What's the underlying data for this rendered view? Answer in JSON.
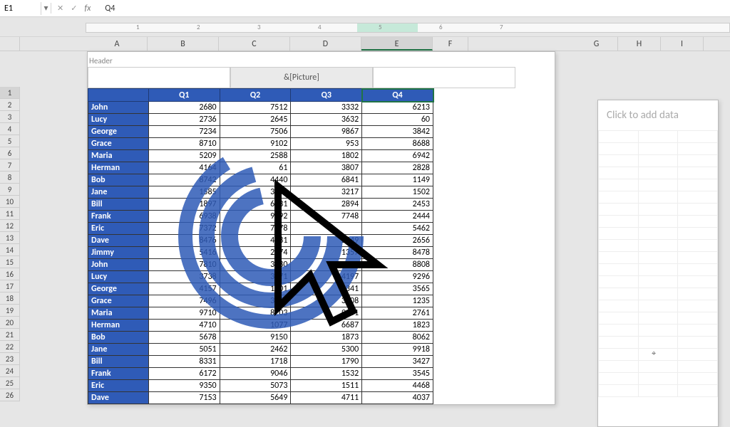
{
  "name_box": "E1",
  "formula_icons": {
    "cancel": "✕",
    "enter": "✓",
    "fx": "fx"
  },
  "formula_value": "Q4",
  "ruler": {
    "ticks": [
      "1",
      "2",
      "3",
      "4",
      "5",
      "6",
      "7"
    ]
  },
  "columns": [
    "A",
    "B",
    "C",
    "D",
    "E",
    "F"
  ],
  "columns2": [
    "G",
    "H",
    "I"
  ],
  "header_section_label": "Header",
  "header_boxes": {
    "left": "",
    "center": "&[Picture]",
    "right": ""
  },
  "table": {
    "headers": [
      "",
      "Q1",
      "Q2",
      "Q3",
      "Q4"
    ],
    "rows": [
      {
        "name": "John",
        "q": [
          2680,
          7512,
          3332,
          6213
        ]
      },
      {
        "name": "Lucy",
        "q": [
          2736,
          2645,
          3632,
          60
        ]
      },
      {
        "name": "George",
        "q": [
          7234,
          7506,
          9867,
          3842
        ]
      },
      {
        "name": "Grace",
        "q": [
          8710,
          9102,
          953,
          8688
        ]
      },
      {
        "name": "Maria",
        "q": [
          5209,
          2588,
          1802,
          6942
        ]
      },
      {
        "name": "Herman",
        "q": [
          4164,
          61,
          3807,
          2828
        ]
      },
      {
        "name": "Bob",
        "q": [
          8742,
          4440,
          6841,
          1149
        ]
      },
      {
        "name": "Jane",
        "q": [
          1585,
          3969,
          3217,
          1502
        ]
      },
      {
        "name": "Bill",
        "q": [
          1897,
          6931,
          2894,
          2453
        ]
      },
      {
        "name": "Frank",
        "q": [
          6938,
          9892,
          7748,
          2444
        ]
      },
      {
        "name": "Eric",
        "q": [
          7372,
          7578,
          "",
          5462
        ]
      },
      {
        "name": "Dave",
        "q": [
          8476,
          4981,
          2849,
          2656
        ]
      },
      {
        "name": "Jimmy",
        "q": [
          5416,
          2974,
          1357,
          8478
        ]
      },
      {
        "name": "John",
        "q": [
          7810,
          3780,
          4195,
          8808
        ]
      },
      {
        "name": "Lucy",
        "q": [
          3738,
          3071,
          4197,
          9296
        ]
      },
      {
        "name": "George",
        "q": [
          4157,
          1401,
          1341,
          3565
        ]
      },
      {
        "name": "Grace",
        "q": [
          7496,
          3856,
          3508,
          1235
        ]
      },
      {
        "name": "Maria",
        "q": [
          9710,
          8203,
          9901,
          2761
        ]
      },
      {
        "name": "Herman",
        "q": [
          4710,
          1077,
          6687,
          1823
        ]
      },
      {
        "name": "Bob",
        "q": [
          5678,
          9150,
          1873,
          8062
        ]
      },
      {
        "name": "Jane",
        "q": [
          5051,
          2462,
          5300,
          9918
        ]
      },
      {
        "name": "Bill",
        "q": [
          8331,
          1718,
          1790,
          3427
        ]
      },
      {
        "name": "Frank",
        "q": [
          6172,
          9046,
          1532,
          3545
        ]
      },
      {
        "name": "Eric",
        "q": [
          9350,
          5073,
          1511,
          4468
        ]
      },
      {
        "name": "Dave",
        "q": [
          7153,
          5649,
          4711,
          4037
        ]
      }
    ]
  },
  "row_numbers": [
    1,
    2,
    3,
    4,
    5,
    6,
    7,
    8,
    9,
    10,
    11,
    12,
    13,
    14,
    15,
    16,
    17,
    18,
    19,
    20,
    21,
    22,
    23,
    24,
    25,
    26
  ],
  "sidebar_placeholder": "Click to add data",
  "selected_cell": "E1",
  "colors": {
    "header_blue": "#2f5bb7",
    "sel_green": "#217346"
  }
}
